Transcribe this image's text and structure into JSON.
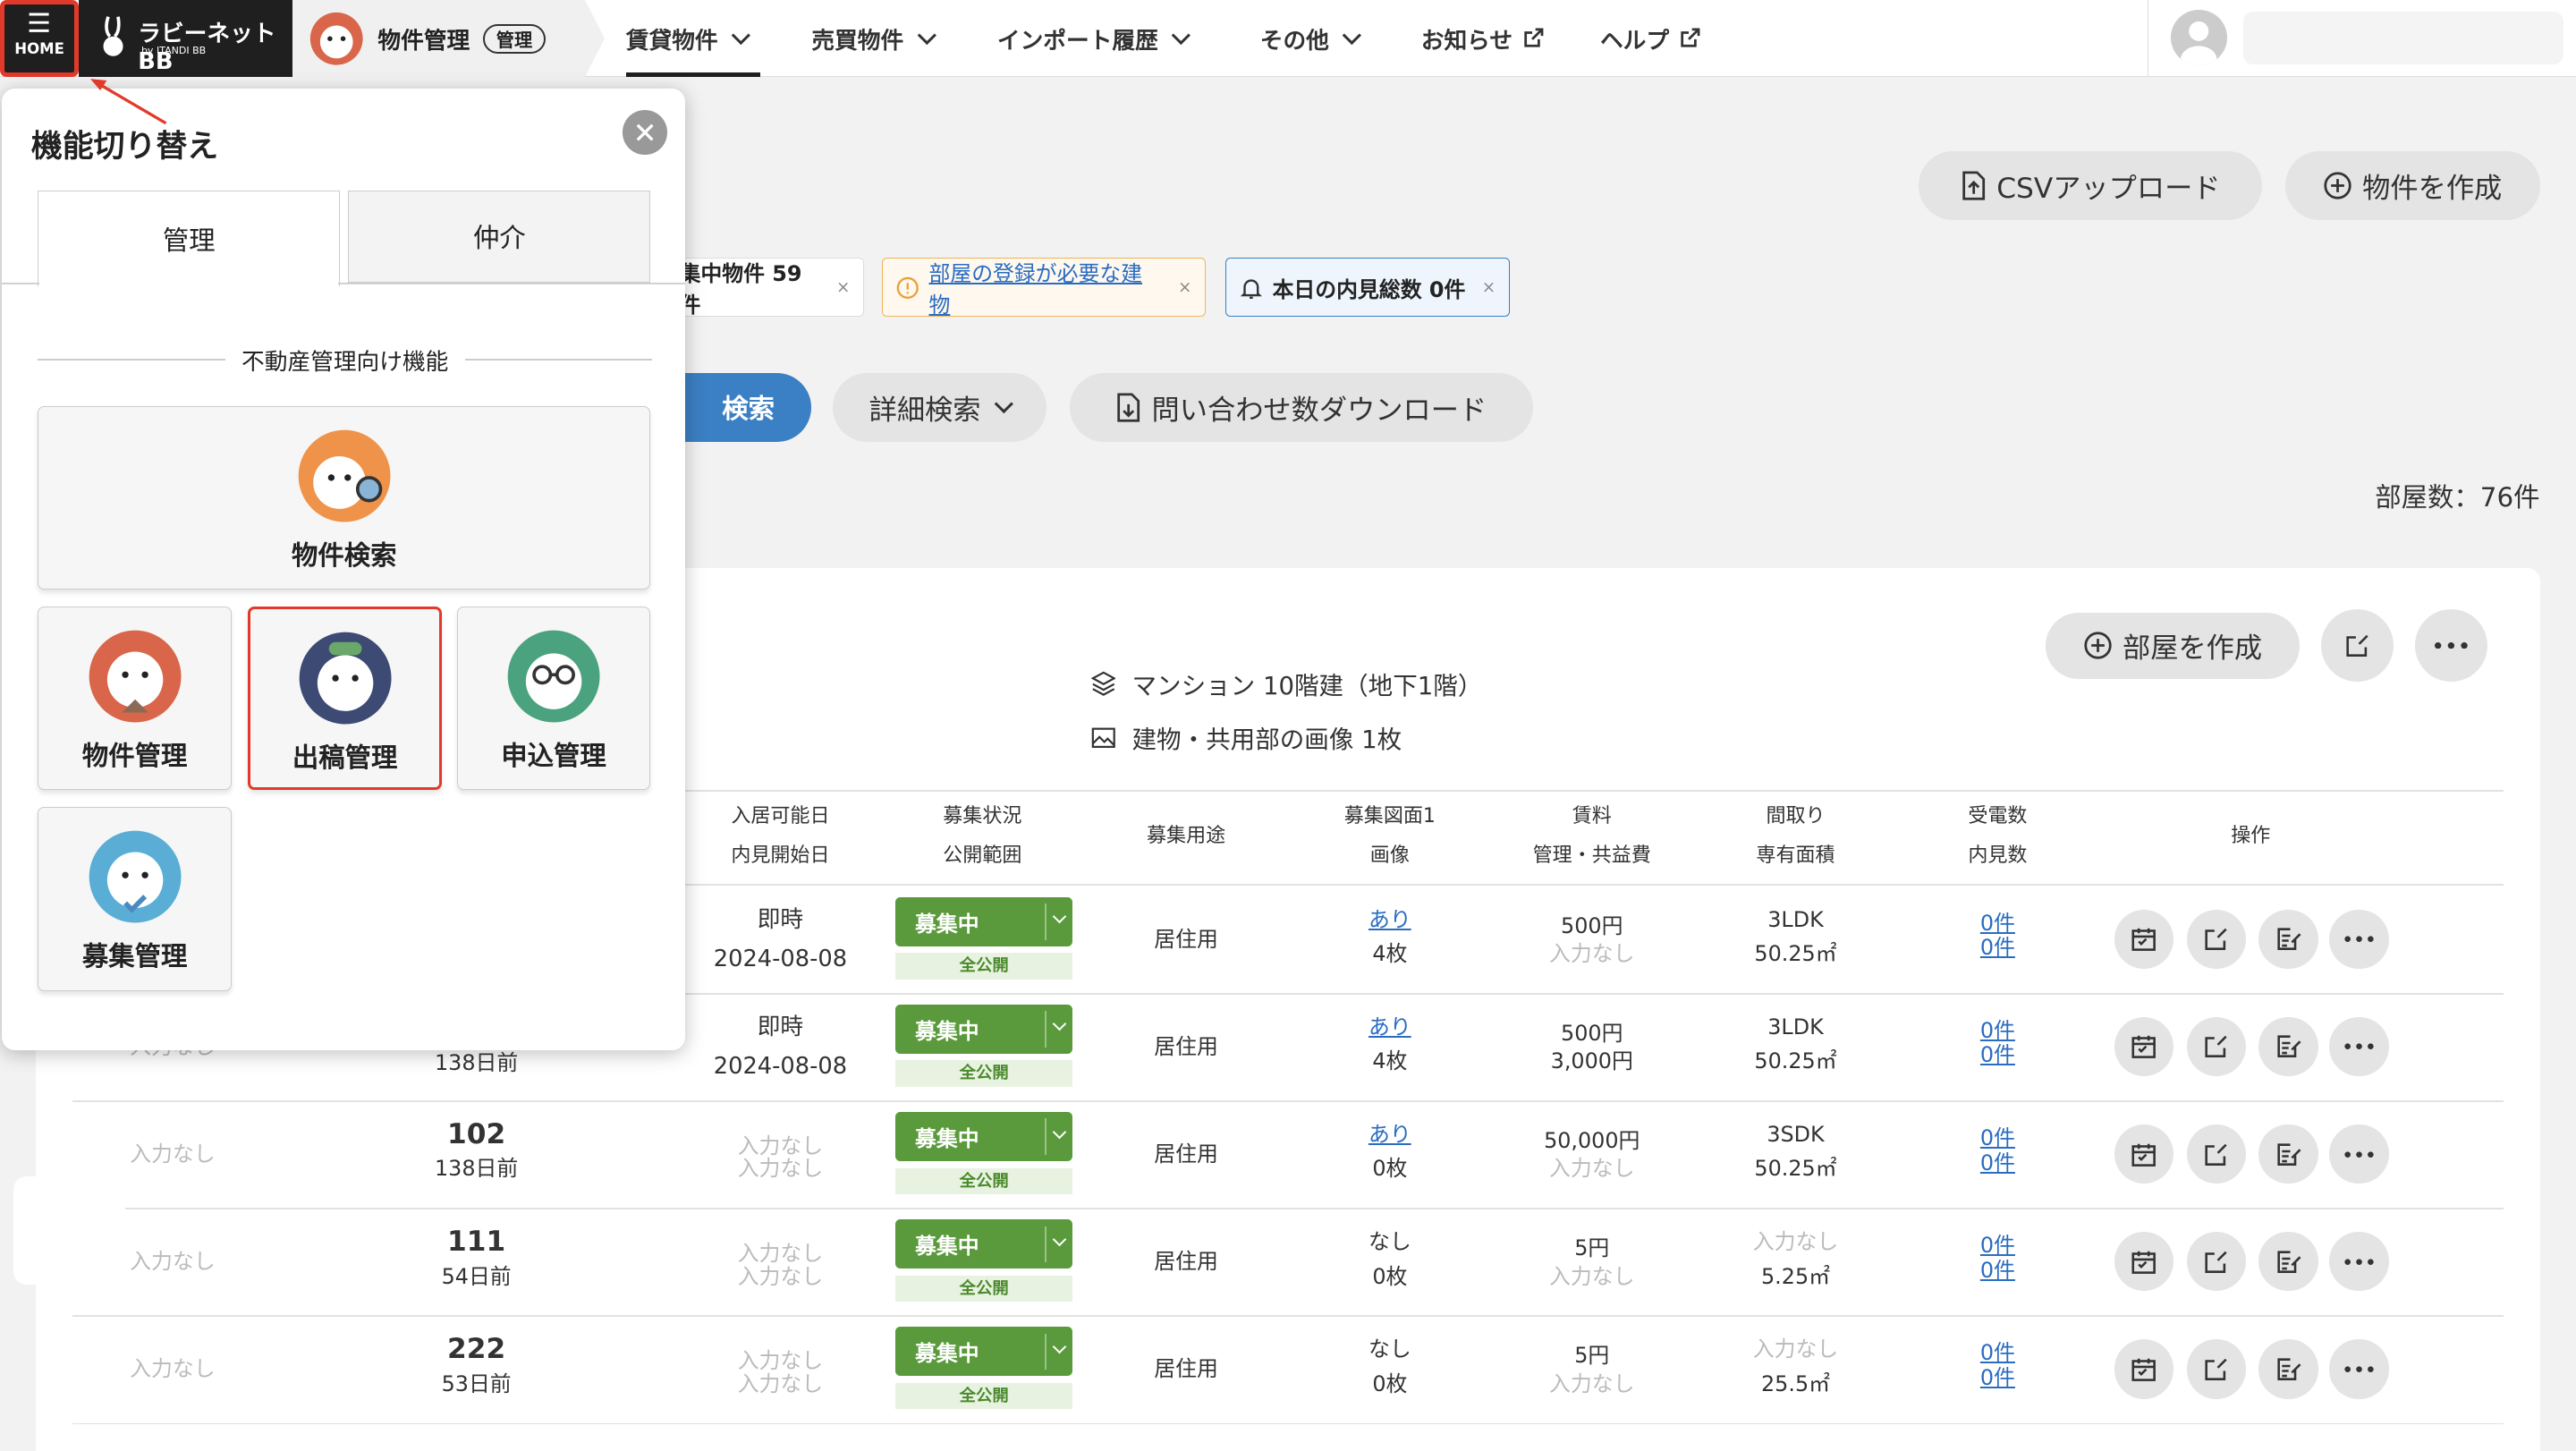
{
  "topbar": {
    "home_label": "HOME",
    "logo_text": "ラビーネットBB",
    "logo_sub": "by ITANDI BB",
    "module_title": "物件管理",
    "module_badge": "管理",
    "nav": [
      "賃貸物件",
      "売買物件",
      "インポート履歴",
      "その他",
      "お知らせ",
      "ヘルプ"
    ]
  },
  "actions": {
    "csv_upload": "CSVアップロード",
    "create_property": "物件を作成"
  },
  "chips": {
    "c1": "集中物件 59件",
    "c2": "部屋の登録が必要な建物",
    "c3": "本日の内見総数 0件"
  },
  "search": {
    "search_btn": "検索",
    "detail": "詳細検索",
    "download": "問い合わせ数ダウンロード"
  },
  "room_count": "部屋数：76件",
  "card": {
    "building_type": "マンション 10階建（地下1階）",
    "images": "建物・共用部の画像 1枚",
    "add_room": "部屋を作成"
  },
  "table": {
    "headers": [
      [
        "入居可能日",
        "内見開始日"
      ],
      [
        "募集状況",
        "公開範囲"
      ],
      [
        "募集用途",
        ""
      ],
      [
        "募集図面1",
        "画像"
      ],
      [
        "賃料",
        "管理・共益費"
      ],
      [
        "間取り",
        "専有面積"
      ],
      [
        "受電数",
        "内見数"
      ],
      [
        "操作",
        ""
      ]
    ],
    "rows": [
      {
        "c0": "",
        "room": "",
        "age": "",
        "avail": "即時",
        "view": "2024-08-08",
        "status": "募集中",
        "pub": "全公開",
        "use": "居住用",
        "plan": "あり",
        "img": "4枚",
        "rent": "500円",
        "fee": "入力なし",
        "layout": "3LDK",
        "area": "50.25㎡",
        "calls": "0件",
        "views": "0件"
      },
      {
        "c0": "入力なし",
        "room": "",
        "age": "138日前",
        "avail": "即時",
        "view": "2024-08-08",
        "status": "募集中",
        "pub": "全公開",
        "use": "居住用",
        "plan": "あり",
        "img": "4枚",
        "rent": "500円",
        "fee": "3,000円",
        "layout": "3LDK",
        "area": "50.25㎡",
        "calls": "0件",
        "views": "0件"
      },
      {
        "c0": "入力なし",
        "room": "102",
        "age": "138日前",
        "avail": "入力なし",
        "view": "入力なし",
        "status": "募集中",
        "pub": "全公開",
        "use": "居住用",
        "plan": "あり",
        "img": "0枚",
        "rent": "50,000円",
        "fee": "入力なし",
        "layout": "3SDK",
        "area": "50.25㎡",
        "calls": "0件",
        "views": "0件"
      },
      {
        "c0": "入力なし",
        "room": "111",
        "age": "54日前",
        "avail": "入力なし",
        "view": "入力なし",
        "status": "募集中",
        "pub": "全公開",
        "use": "居住用",
        "plan": "なし",
        "img": "0枚",
        "rent": "5円",
        "fee": "入力なし",
        "layout": "入力なし",
        "area": "5.25㎡",
        "calls": "0件",
        "views": "0件"
      },
      {
        "c0": "入力なし",
        "room": "222",
        "age": "53日前",
        "avail": "入力なし",
        "view": "入力なし",
        "status": "募集中",
        "pub": "全公開",
        "use": "居住用",
        "plan": "なし",
        "img": "0枚",
        "rent": "5円",
        "fee": "入力なし",
        "layout": "入力なし",
        "area": "25.5㎡",
        "calls": "0件",
        "views": "0件"
      }
    ]
  },
  "panel": {
    "title": "機能切り替え",
    "tab_manage": "管理",
    "tab_broker": "仲介",
    "section": "不動産管理向け機能",
    "items": [
      "物件検索",
      "物件管理",
      "出稿管理",
      "申込管理",
      "募集管理"
    ]
  },
  "colors": {
    "accent_red": "#e23a2a",
    "status_green": "#5a9a3c",
    "link_blue": "#2a6cc2",
    "search_blue": "#3b7fc4"
  }
}
